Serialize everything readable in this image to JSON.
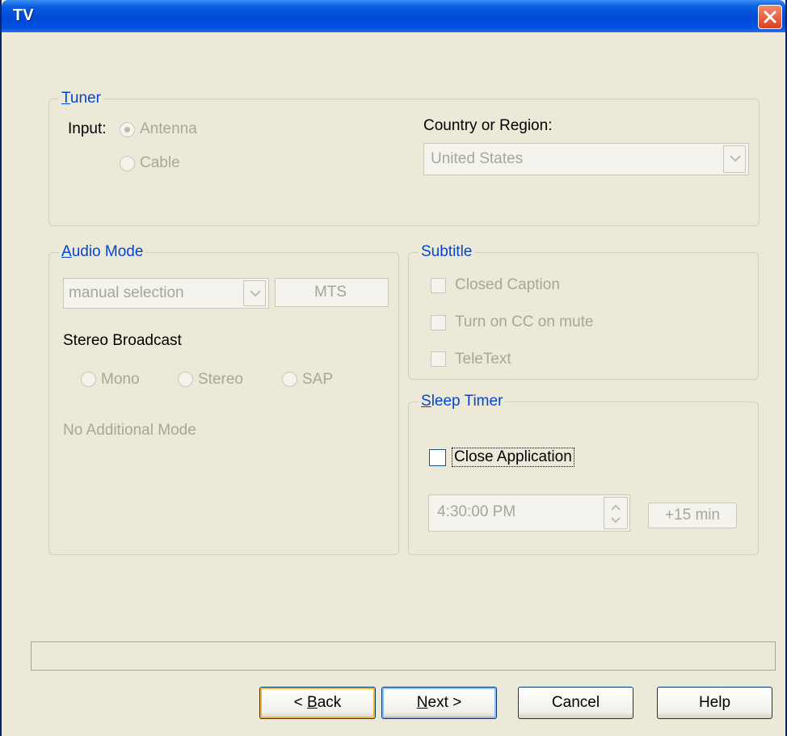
{
  "window": {
    "title": "TV"
  },
  "tuner": {
    "legend_first": "T",
    "legend_rest": "uner",
    "input_label": "Input:",
    "antenna": "Antenna",
    "cable": "Cable",
    "country_label": "Country or Region:",
    "country_value": "United States"
  },
  "audio": {
    "legend_first": "A",
    "legend_rest": "udio Mode",
    "mode_value": "manual selection",
    "mts_label": "MTS",
    "stereo_heading": "Stereo Broadcast",
    "mono": "Mono",
    "stereo": "Stereo",
    "sap": "SAP",
    "additional": "No Additional Mode"
  },
  "subtitle": {
    "legend": "Subtitle",
    "closed_caption": "Closed Caption",
    "cc_on_mute": "Turn on CC on mute",
    "teletext": "TeleText"
  },
  "sleep": {
    "legend_first": "S",
    "legend_rest": "leep Timer",
    "close_app": "Close Application",
    "time": "4:30:00 PM",
    "plus15": "+15 min"
  },
  "buttons": {
    "back_prefix": "< ",
    "back_mn": "B",
    "back_rest": "ack",
    "next_mn": "N",
    "next_rest": "ext >",
    "cancel": "Cancel",
    "help": "Help"
  }
}
